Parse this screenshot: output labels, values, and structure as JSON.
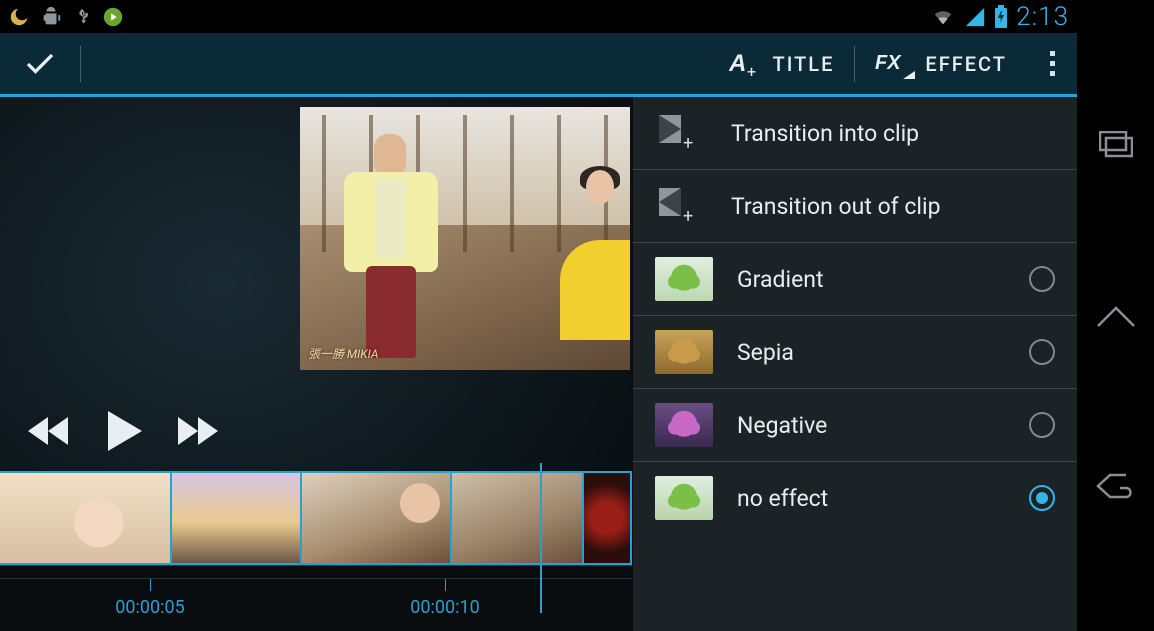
{
  "status": {
    "time": "2:13"
  },
  "actionbar": {
    "title_label": "TITLE",
    "effect_label": "EFFECT"
  },
  "preview": {
    "watermark": "張一勝 MIKIA"
  },
  "timeline": {
    "tick1": "00:00:05",
    "tick2": "00:00:10"
  },
  "panel": {
    "transition_in": "Transition into clip",
    "transition_out": "Transition out of clip",
    "effects": [
      {
        "label": "Gradient",
        "selected": false
      },
      {
        "label": "Sepia",
        "selected": false
      },
      {
        "label": "Negative",
        "selected": false
      },
      {
        "label": "no effect",
        "selected": true
      }
    ]
  }
}
